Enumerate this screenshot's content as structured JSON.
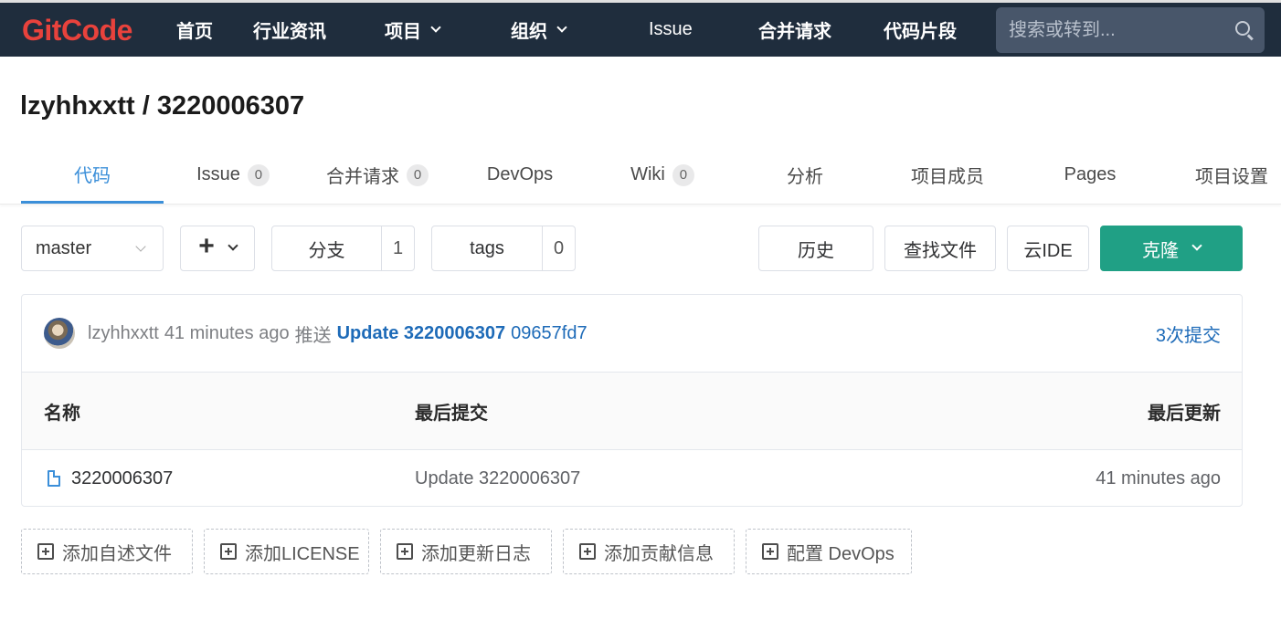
{
  "header": {
    "logo_text": "GitCode",
    "nav": [
      {
        "label": "首页"
      },
      {
        "label": "行业资讯"
      },
      {
        "label": "项目"
      },
      {
        "label": "组织"
      },
      {
        "label": "Issue"
      },
      {
        "label": "合并请求"
      },
      {
        "label": "代码片段"
      }
    ],
    "search_placeholder": "搜索或转到..."
  },
  "repo": {
    "owner": "lzyhhxxtt",
    "separator": " / ",
    "name": "3220006307"
  },
  "tabs": [
    {
      "label": "代码",
      "active": true
    },
    {
      "label": "Issue",
      "count": "0"
    },
    {
      "label": "合并请求",
      "count": "0"
    },
    {
      "label": "DevOps"
    },
    {
      "label": "Wiki",
      "count": "0"
    },
    {
      "label": "分析"
    },
    {
      "label": "项目成员"
    },
    {
      "label": "Pages"
    },
    {
      "label": "项目设置"
    }
  ],
  "toolbar": {
    "branch": "master",
    "branches_label": "分支",
    "branches_count": "1",
    "tags_label": "tags",
    "tags_count": "0",
    "history_label": "历史",
    "find_file_label": "查找文件",
    "web_ide_label": "云IDE",
    "clone_label": "克隆"
  },
  "last_commit": {
    "author": "lzyhhxxtt",
    "time": "41 minutes ago",
    "action": "推送",
    "message": "Update 3220006307",
    "sha": "09657fd7",
    "commit_count": "3次提交"
  },
  "file_table": {
    "headers": {
      "name": "名称",
      "last_commit": "最后提交",
      "last_update": "最后更新"
    },
    "rows": [
      {
        "name": "3220006307",
        "last_commit": "Update 3220006307",
        "last_update": "41 minutes ago"
      }
    ]
  },
  "suggestions": [
    {
      "label": "添加自述文件"
    },
    {
      "label": "添加LICENSE"
    },
    {
      "label": "添加更新日志"
    },
    {
      "label": "添加贡献信息"
    },
    {
      "label": "配置 DevOps"
    }
  ],
  "colors": {
    "nav_bg": "#1f2d3d",
    "brand": "#e8423c",
    "accent_link": "#1e6bb8",
    "active_tab": "#3b8fd9",
    "clone_button": "#20a085"
  }
}
